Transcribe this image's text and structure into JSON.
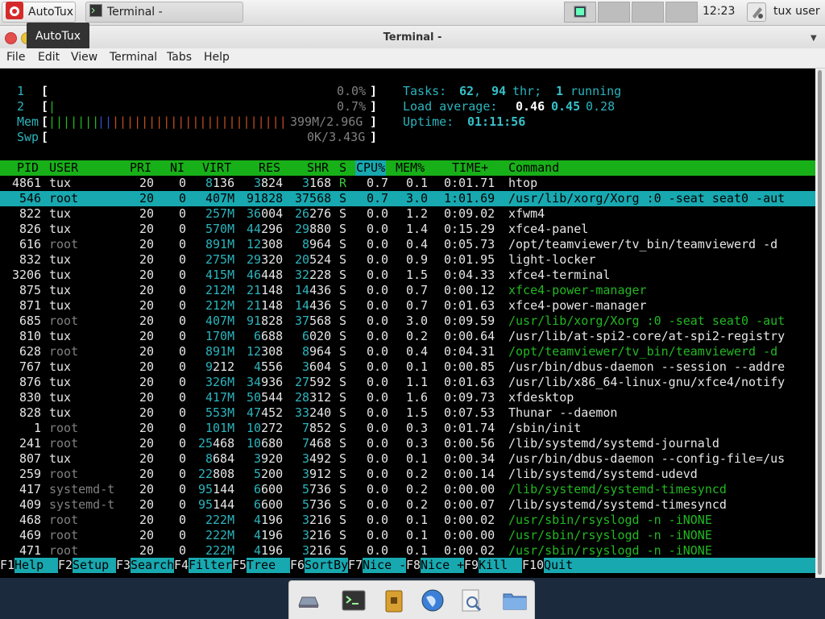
{
  "panel": {
    "app_label": "AutoTux",
    "task_label": "Terminal -",
    "clock": "12:23",
    "user": "tux user"
  },
  "tooltip": "AutoTux",
  "window": {
    "title": "Terminal -",
    "menu": [
      "File",
      "Edit",
      "View",
      "Terminal",
      "Tabs",
      "Help"
    ]
  },
  "htop": {
    "cpu1": {
      "label": "1",
      "pct": "0.0%",
      "level": 0.0
    },
    "cpu2": {
      "label": "2",
      "pct": "0.7%",
      "level": 0.007
    },
    "mem": {
      "label": "Mem",
      "value": "399M/2.96G"
    },
    "swp": {
      "label": "Swp",
      "value": "0K/3.43G"
    },
    "tasks_label": "Tasks:",
    "tasks_count": "62",
    "threads": "94",
    "threads_label": "thr;",
    "running": "1",
    "running_label": "running",
    "load_label": "Load average:",
    "load1": "0.46",
    "load5": "0.45",
    "load15": "0.28",
    "uptime_label": "Uptime:",
    "uptime": "01:11:56",
    "columns": [
      "PID",
      "USER",
      "PRI",
      "NI",
      "VIRT",
      "RES",
      "SHR",
      "S",
      "CPU%",
      "MEM%",
      "TIME+",
      "Command"
    ],
    "rows": [
      [
        "4861",
        "tux",
        "20",
        "0",
        "8136",
        "3824",
        "3168",
        "R",
        "0.7",
        "0.1",
        "0:01.71",
        "htop"
      ],
      [
        "546",
        "root",
        "20",
        "0",
        "407M",
        "91828",
        "37568",
        "S",
        "0.7",
        "3.0",
        "1:01.69",
        "/usr/lib/xorg/Xorg :0 -seat seat0 -aut"
      ],
      [
        "822",
        "tux",
        "20",
        "0",
        "257M",
        "36004",
        "26276",
        "S",
        "0.0",
        "1.2",
        "0:09.02",
        "xfwm4"
      ],
      [
        "826",
        "tux",
        "20",
        "0",
        "570M",
        "44296",
        "29880",
        "S",
        "0.0",
        "1.4",
        "0:15.29",
        "xfce4-panel"
      ],
      [
        "616",
        "root",
        "20",
        "0",
        "891M",
        "12308",
        "8964",
        "S",
        "0.0",
        "0.4",
        "0:05.73",
        "/opt/teamviewer/tv_bin/teamviewerd -d"
      ],
      [
        "832",
        "tux",
        "20",
        "0",
        "275M",
        "29320",
        "20524",
        "S",
        "0.0",
        "0.9",
        "0:01.95",
        "light-locker"
      ],
      [
        "3206",
        "tux",
        "20",
        "0",
        "415M",
        "46448",
        "32228",
        "S",
        "0.0",
        "1.5",
        "0:04.33",
        "xfce4-terminal"
      ],
      [
        "875",
        "tux",
        "20",
        "0",
        "212M",
        "21148",
        "14436",
        "S",
        "0.0",
        "0.7",
        "0:00.12",
        "xfce4-power-manager"
      ],
      [
        "871",
        "tux",
        "20",
        "0",
        "212M",
        "21148",
        "14436",
        "S",
        "0.0",
        "0.7",
        "0:01.63",
        "xfce4-power-manager"
      ],
      [
        "685",
        "root",
        "20",
        "0",
        "407M",
        "91828",
        "37568",
        "S",
        "0.0",
        "3.0",
        "0:09.59",
        "/usr/lib/xorg/Xorg :0 -seat seat0 -aut"
      ],
      [
        "810",
        "tux",
        "20",
        "0",
        "170M",
        "6688",
        "6020",
        "S",
        "0.0",
        "0.2",
        "0:00.64",
        "/usr/lib/at-spi2-core/at-spi2-registry"
      ],
      [
        "628",
        "root",
        "20",
        "0",
        "891M",
        "12308",
        "8964",
        "S",
        "0.0",
        "0.4",
        "0:04.31",
        "/opt/teamviewer/tv_bin/teamviewerd -d"
      ],
      [
        "767",
        "tux",
        "20",
        "0",
        "9212",
        "4556",
        "3604",
        "S",
        "0.0",
        "0.1",
        "0:00.85",
        "/usr/bin/dbus-daemon --session --addre"
      ],
      [
        "876",
        "tux",
        "20",
        "0",
        "326M",
        "34936",
        "27592",
        "S",
        "0.0",
        "1.1",
        "0:01.63",
        "/usr/lib/x86_64-linux-gnu/xfce4/notify"
      ],
      [
        "830",
        "tux",
        "20",
        "0",
        "417M",
        "50544",
        "28312",
        "S",
        "0.0",
        "1.6",
        "0:09.73",
        "xfdesktop"
      ],
      [
        "828",
        "tux",
        "20",
        "0",
        "553M",
        "47452",
        "33240",
        "S",
        "0.0",
        "1.5",
        "0:07.53",
        "Thunar --daemon"
      ],
      [
        "1",
        "root",
        "20",
        "0",
        "101M",
        "10272",
        "7852",
        "S",
        "0.0",
        "0.3",
        "0:01.74",
        "/sbin/init"
      ],
      [
        "241",
        "root",
        "20",
        "0",
        "25468",
        "10680",
        "7468",
        "S",
        "0.0",
        "0.3",
        "0:00.56",
        "/lib/systemd/systemd-journald"
      ],
      [
        "807",
        "tux",
        "20",
        "0",
        "8684",
        "3920",
        "3492",
        "S",
        "0.0",
        "0.1",
        "0:00.34",
        "/usr/bin/dbus-daemon --config-file=/us"
      ],
      [
        "259",
        "root",
        "20",
        "0",
        "22808",
        "5200",
        "3912",
        "S",
        "0.0",
        "0.2",
        "0:00.14",
        "/lib/systemd/systemd-udevd"
      ],
      [
        "417",
        "systemd-t",
        "20",
        "0",
        "95144",
        "6600",
        "5736",
        "S",
        "0.0",
        "0.2",
        "0:00.00",
        "/lib/systemd/systemd-timesyncd"
      ],
      [
        "409",
        "systemd-t",
        "20",
        "0",
        "95144",
        "6600",
        "5736",
        "S",
        "0.0",
        "0.2",
        "0:00.07",
        "/lib/systemd/systemd-timesyncd"
      ],
      [
        "468",
        "root",
        "20",
        "0",
        "222M",
        "4196",
        "3216",
        "S",
        "0.0",
        "0.1",
        "0:00.02",
        "/usr/sbin/rsyslogd -n -iNONE"
      ],
      [
        "469",
        "root",
        "20",
        "0",
        "222M",
        "4196",
        "3216",
        "S",
        "0.0",
        "0.1",
        "0:00.00",
        "/usr/sbin/rsyslogd -n -iNONE"
      ],
      [
        "471",
        "root",
        "20",
        "0",
        "222M",
        "4196",
        "3216",
        "S",
        "0.0",
        "0.1",
        "0:00.02",
        "/usr/sbin/rsyslogd -n -iNONE"
      ]
    ],
    "selected_row": 1,
    "thread_rows": [
      7,
      9,
      11,
      20,
      22,
      23,
      24
    ],
    "dim_user_rows": [
      4,
      9,
      11,
      16,
      17,
      19,
      20,
      21,
      22,
      23,
      24
    ],
    "fkeys": [
      {
        "key": "F1",
        "label": "Help  "
      },
      {
        "key": "F2",
        "label": "Setup "
      },
      {
        "key": "F3",
        "label": "Search"
      },
      {
        "key": "F4",
        "label": "Filter"
      },
      {
        "key": "F5",
        "label": "Tree  "
      },
      {
        "key": "F6",
        "label": "SortBy"
      },
      {
        "key": "F7",
        "label": "Nice -"
      },
      {
        "key": "F8",
        "label": "Nice +"
      },
      {
        "key": "F9",
        "label": "Kill  "
      },
      {
        "key": "F10",
        "label": "Quit  "
      }
    ]
  },
  "dock": [
    "show-desktop-icon",
    "terminal-icon",
    "archive-icon",
    "web-browser-icon",
    "search-icon",
    "folder-icon"
  ]
}
